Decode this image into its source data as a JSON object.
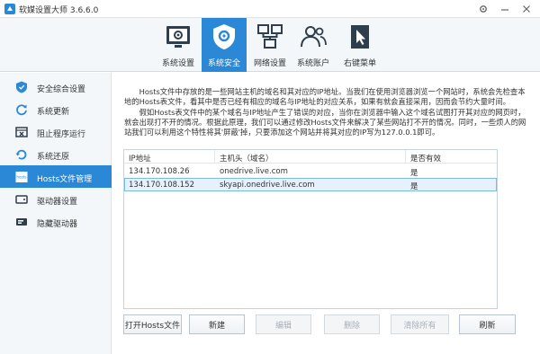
{
  "window": {
    "title": "软媒设置大师 3.6.6.0"
  },
  "toolbar": {
    "tabs": [
      {
        "label": "系统设置",
        "icon": "system-settings-icon"
      },
      {
        "label": "系统安全",
        "icon": "shield-gear-icon"
      },
      {
        "label": "网络设置",
        "icon": "network-icon"
      },
      {
        "label": "系统账户",
        "icon": "users-icon"
      },
      {
        "label": "右键菜单",
        "icon": "cursor-icon"
      }
    ],
    "active_index": 1
  },
  "sidebar": {
    "items": [
      {
        "label": "安全综合设置",
        "icon": "shield-icon"
      },
      {
        "label": "系统更新",
        "icon": "refresh-icon"
      },
      {
        "label": "阻止程序运行",
        "icon": "block-window-icon"
      },
      {
        "label": "系统还原",
        "icon": "restore-icon"
      },
      {
        "label": "Hosts文件管理",
        "icon": "hosts-icon"
      },
      {
        "label": "驱动器设置",
        "icon": "drive-icon"
      },
      {
        "label": "隐藏驱动器",
        "icon": "hidden-drive-icon"
      }
    ],
    "active_index": 4
  },
  "description": {
    "p1": "Hosts文件中存放的是一些网站主机的域名和其对应的IP地址。当我们在使用浏览器浏览一个网站时，系统会先检查本地的Hosts表文件，看其中是否已经有相应的域名与IP地址的对应关系，如果有就会直接采用，因而会节约大量时间。",
    "p2": "假如Hosts表文件中的某个域名与IP地址产生了错误的对应，当你在浏览器中输入这个域名试图打开其对应的网页时，就会出现打不开的情况。根据此原理，我们可以通过修改Hosts文件来解决了某些网站打不开的情况。同时，一些烦人的网站我们可以利用这个特性将其'屏蔽'掉，只要添加这个网站并将其对应的IP写为127.0.0.1即可。"
  },
  "table": {
    "headers": [
      "IP地址",
      "主机头（域名）",
      "是否有效"
    ],
    "rows": [
      {
        "ip": "134.170.108.26",
        "host": "onedrive.live.com",
        "valid": "是"
      },
      {
        "ip": "134.170.108.152",
        "host": "skyapi.onedrive.live.com",
        "valid": "是"
      }
    ],
    "selected_index": 1
  },
  "buttons": {
    "open_hosts": "打开Hosts文件",
    "new": "新建",
    "edit": "编辑",
    "delete": "删除",
    "clear_all": "清除所有",
    "refresh": "刷新"
  },
  "colors": {
    "accent": "#2a88d6",
    "selection_bg": "#e5f1fb"
  }
}
